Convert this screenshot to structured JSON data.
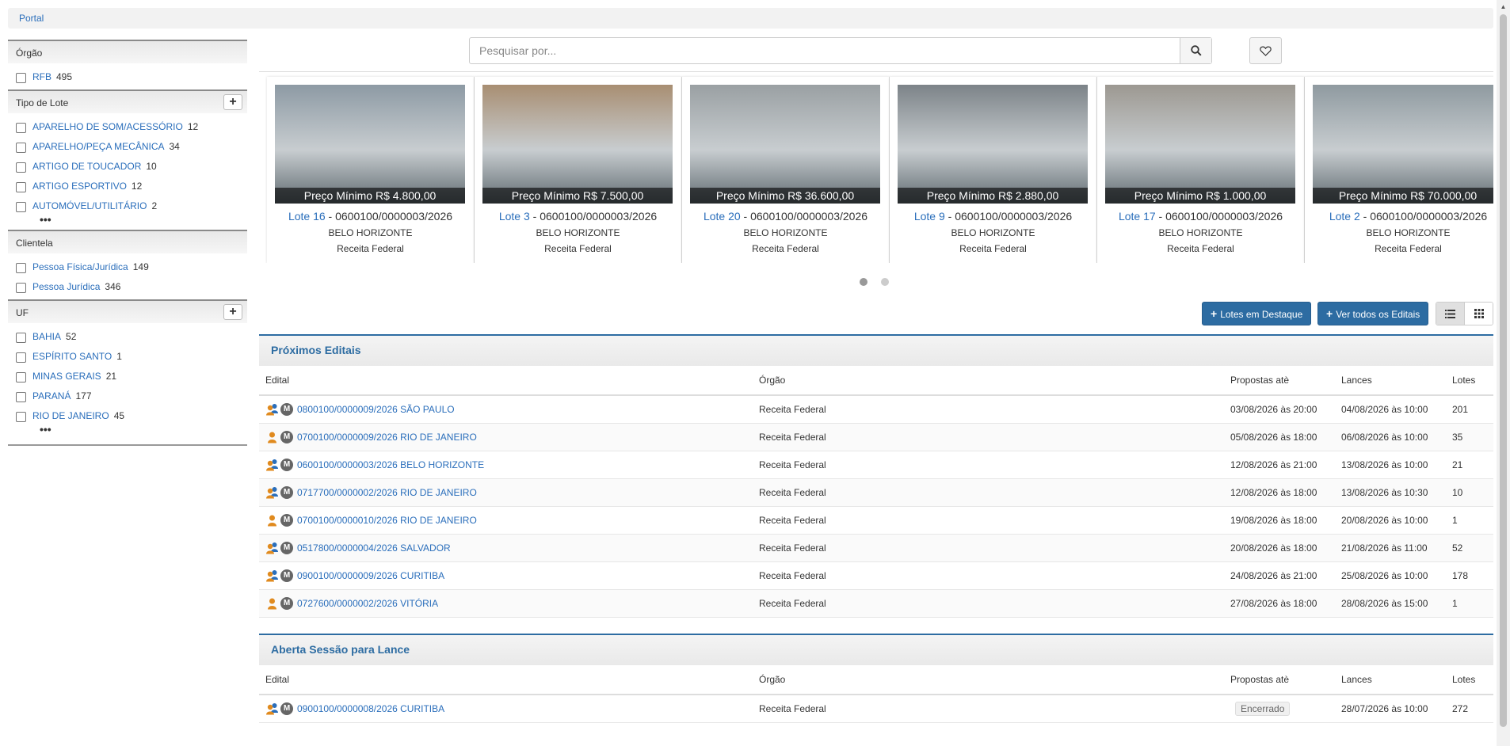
{
  "breadcrumb": {
    "label": "Portal"
  },
  "sidebar": {
    "facets": [
      {
        "title": "Órgão",
        "expandable": false,
        "more": false,
        "items": [
          {
            "label": "RFB",
            "count": "495"
          }
        ]
      },
      {
        "title": "Tipo de Lote",
        "expandable": true,
        "more": true,
        "items": [
          {
            "label": "APARELHO DE SOM/ACESSÓRIO",
            "count": "12"
          },
          {
            "label": "APARELHO/PEÇA MECÂNICA",
            "count": "34"
          },
          {
            "label": "ARTIGO DE TOUCADOR",
            "count": "10"
          },
          {
            "label": "ARTIGO ESPORTIVO",
            "count": "12"
          },
          {
            "label": "AUTOMÓVEL/UTILITÁRIO",
            "count": "2"
          }
        ]
      },
      {
        "title": "Clientela",
        "expandable": false,
        "more": false,
        "items": [
          {
            "label": "Pessoa Física/Jurídica",
            "count": "149"
          },
          {
            "label": "Pessoa Jurídica",
            "count": "346"
          }
        ]
      },
      {
        "title": "UF",
        "expandable": true,
        "more": true,
        "items": [
          {
            "label": "BAHIA",
            "count": "52"
          },
          {
            "label": "ESPÍRITO SANTO",
            "count": "1"
          },
          {
            "label": "MINAS GERAIS",
            "count": "21"
          },
          {
            "label": "PARANÁ",
            "count": "177"
          },
          {
            "label": "RIO DE JANEIRO",
            "count": "45"
          }
        ]
      }
    ],
    "more_label": "•••"
  },
  "search": {
    "placeholder": "Pesquisar por..."
  },
  "carousel": {
    "cards": [
      {
        "price": "Preço Mínimo R$ 4.800,00",
        "lote": "Lote 16",
        "edital": " - 0600100/0000003/2026",
        "city": "BELO HORIZONTE",
        "org": "Receita Federal",
        "color": "#8d9aa4"
      },
      {
        "price": "Preço Mínimo R$ 7.500,00",
        "lote": "Lote 3",
        "edital": " - 0600100/0000003/2026",
        "city": "BELO HORIZONTE",
        "org": "Receita Federal",
        "color": "#a88e72"
      },
      {
        "price": "Preço Mínimo R$ 36.600,00",
        "lote": "Lote 20",
        "edital": " - 0600100/0000003/2026",
        "city": "BELO HORIZONTE",
        "org": "Receita Federal",
        "color": "#9aa0a3"
      },
      {
        "price": "Preço Mínimo R$ 2.880,00",
        "lote": "Lote 9",
        "edital": " - 0600100/0000003/2026",
        "city": "BELO HORIZONTE",
        "org": "Receita Federal",
        "color": "#7c8388"
      },
      {
        "price": "Preço Mínimo R$ 1.000,00",
        "lote": "Lote 17",
        "edital": " - 0600100/0000003/2026",
        "city": "BELO HORIZONTE",
        "org": "Receita Federal",
        "color": "#9c9891"
      },
      {
        "price": "Preço Mínimo R$ 70.000,00",
        "lote": "Lote 2",
        "edital": " - 0600100/0000003/2026",
        "city": "BELO HORIZONTE",
        "org": "Receita Federal",
        "color": "#8f9aa0"
      }
    ]
  },
  "actions": {
    "destaque": "Lotes em Destaque",
    "editais": "Ver todos os Editais",
    "plus": "+"
  },
  "proximos": {
    "title": "Próximos Editais",
    "columns": [
      "Edital",
      "Órgão",
      "Propostas atè",
      "Lances",
      "Lotes"
    ],
    "rows": [
      {
        "icon": "people",
        "edital": "0800100/0000009/2026 SÃO PAULO",
        "orgao": "Receita Federal",
        "propostas": "03/08/2026 às 20:00",
        "lances": "04/08/2026 às 10:00",
        "lotes": "201"
      },
      {
        "icon": "person",
        "edital": "0700100/0000009/2026 RIO DE JANEIRO",
        "orgao": "Receita Federal",
        "propostas": "05/08/2026 às 18:00",
        "lances": "06/08/2026 às 10:00",
        "lotes": "35"
      },
      {
        "icon": "people",
        "edital": "0600100/0000003/2026 BELO HORIZONTE",
        "orgao": "Receita Federal",
        "propostas": "12/08/2026 às 21:00",
        "lances": "13/08/2026 às 10:00",
        "lotes": "21"
      },
      {
        "icon": "people",
        "edital": "0717700/0000002/2026 RIO DE JANEIRO",
        "orgao": "Receita Federal",
        "propostas": "12/08/2026 às 18:00",
        "lances": "13/08/2026 às 10:30",
        "lotes": "10"
      },
      {
        "icon": "person",
        "edital": "0700100/0000010/2026 RIO DE JANEIRO",
        "orgao": "Receita Federal",
        "propostas": "19/08/2026 às 18:00",
        "lances": "20/08/2026 às 10:00",
        "lotes": "1"
      },
      {
        "icon": "people",
        "edital": "0517800/0000004/2026 SALVADOR",
        "orgao": "Receita Federal",
        "propostas": "20/08/2026 às 18:00",
        "lances": "21/08/2026 às 11:00",
        "lotes": "52"
      },
      {
        "icon": "people",
        "edital": "0900100/0000009/2026 CURITIBA",
        "orgao": "Receita Federal",
        "propostas": "24/08/2026 às 21:00",
        "lances": "25/08/2026 às 10:00",
        "lotes": "178"
      },
      {
        "icon": "person",
        "edital": "0727600/0000002/2026 VITÓRIA",
        "orgao": "Receita Federal",
        "propostas": "27/08/2026 às 18:00",
        "lances": "28/08/2026 às 15:00",
        "lotes": "1"
      }
    ]
  },
  "aberta": {
    "title": "Aberta Sessão para Lance",
    "columns": [
      "Edital",
      "Órgão",
      "Propostas atè",
      "Lances",
      "Lotes"
    ],
    "rows": [
      {
        "icon": "people",
        "edital": "0900100/0000008/2026 CURITIBA",
        "orgao": "Receita Federal",
        "propostas": "Encerrado",
        "lances": "28/07/2026 às 10:00",
        "lotes": "272"
      }
    ]
  },
  "m_label": "M",
  "colors": {
    "primary": "#2d6ca2",
    "link": "#2a6ebb"
  }
}
